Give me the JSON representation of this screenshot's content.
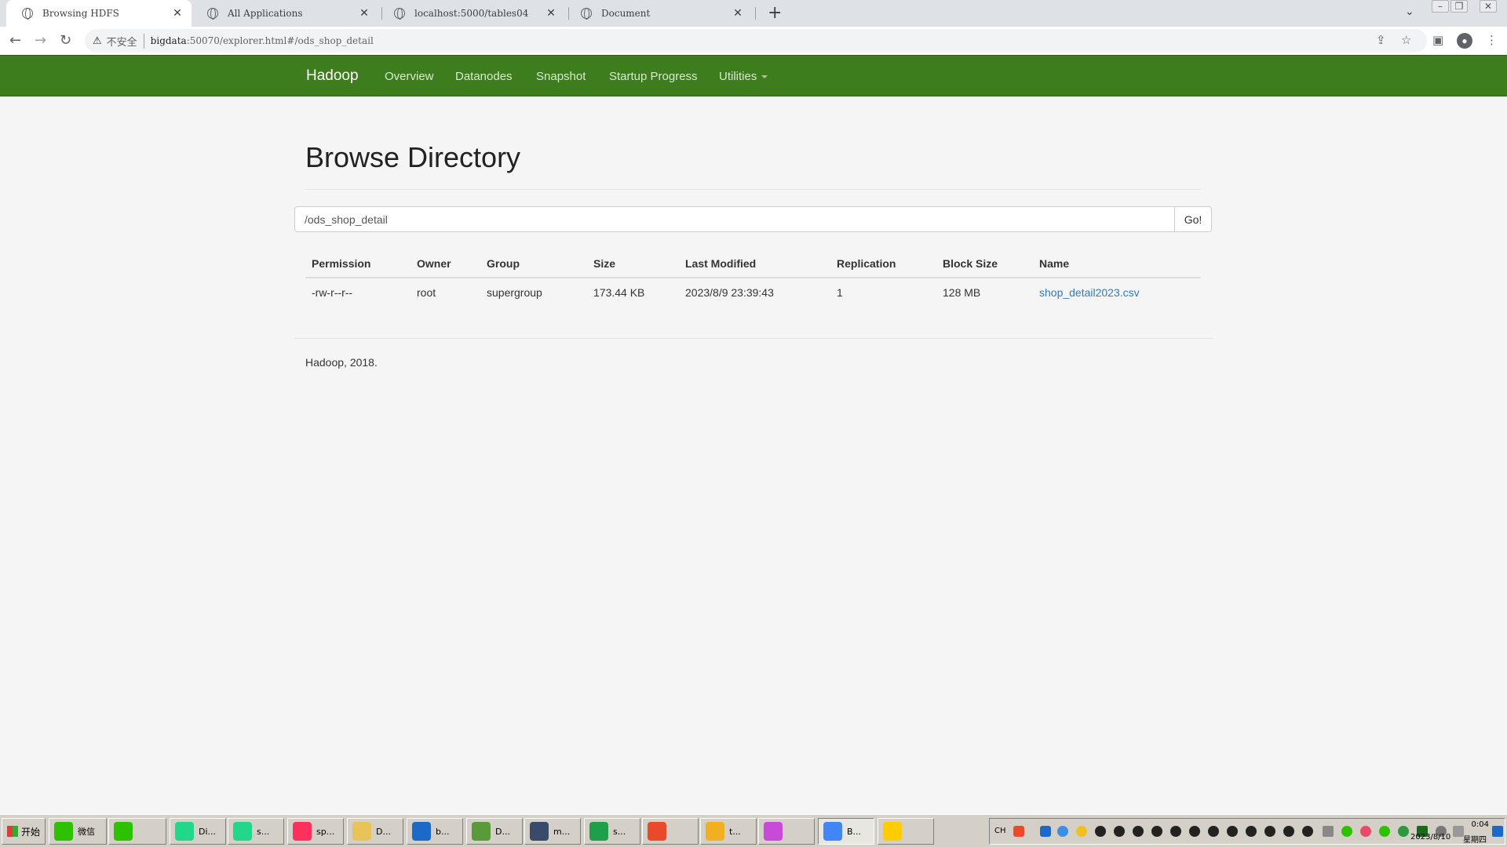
{
  "browser": {
    "tabs": [
      {
        "title": "Browsing HDFS",
        "active": true
      },
      {
        "title": "All Applications",
        "active": false
      },
      {
        "title": "localhost:5000/tables04",
        "active": false
      },
      {
        "title": "Document",
        "active": false
      }
    ],
    "close_glyph": "✕",
    "new_tab_glyph": "+",
    "security_label": "不安全",
    "url_host": "bigdata",
    "url_rest": ":50070/explorer.html#/ods_shop_detail"
  },
  "navbar": {
    "brand": "Hadoop",
    "links": [
      "Overview",
      "Datanodes",
      "Snapshot",
      "Startup Progress",
      "Utilities"
    ]
  },
  "page": {
    "title": "Browse Directory",
    "path_value": "/ods_shop_detail",
    "go_label": "Go!"
  },
  "table": {
    "headers": [
      "Permission",
      "Owner",
      "Group",
      "Size",
      "Last Modified",
      "Replication",
      "Block Size",
      "Name"
    ],
    "rows": [
      [
        "-rw-r--r--",
        "root",
        "supergroup",
        "173.44 KB",
        "2023/8/9 23:39:43",
        "1",
        "128 MB",
        "shop_detail2023.csv"
      ]
    ]
  },
  "footer": {
    "text": "Hadoop, 2018."
  },
  "taskbar": {
    "start_label": "开始",
    "buttons": [
      {
        "label": "微信",
        "icon": "wechat-icon",
        "color": "#2dc100"
      },
      {
        "label": "",
        "icon": "wechat-icon",
        "color": "#2dc100"
      },
      {
        "label": "Di...",
        "icon": "pycharm-icon",
        "color": "#21d789"
      },
      {
        "label": "s...",
        "icon": "pycharm-icon",
        "color": "#21d789"
      },
      {
        "label": "sp...",
        "icon": "intellij-icon",
        "color": "#fe315d"
      },
      {
        "label": "D...",
        "icon": "folder-icon",
        "color": "#e8c35a"
      },
      {
        "label": "b...",
        "icon": "virtualbox-icon",
        "color": "#1b6ac9"
      },
      {
        "label": "D...",
        "icon": "notepad-icon",
        "color": "#5a9a3a"
      },
      {
        "label": "m...",
        "icon": "terminal-icon",
        "color": "#3a4a6a"
      },
      {
        "label": "s...",
        "icon": "hbuilder-icon",
        "color": "#1ea04a"
      },
      {
        "label": "",
        "icon": "swirl-icon",
        "color": "#e84a2a"
      },
      {
        "label": "t...",
        "icon": "paw-icon",
        "color": "#f0b020"
      },
      {
        "label": "",
        "icon": "color-wheel-icon",
        "color": "#c84ad8"
      },
      {
        "label": "B...",
        "icon": "chrome-icon",
        "color": "#4285f4"
      },
      {
        "label": "",
        "icon": "music-icon",
        "color": "#ffcc00"
      }
    ],
    "ime": "CH",
    "time": "0:04",
    "date": "2023/8/10",
    "weekday": "星期四"
  }
}
